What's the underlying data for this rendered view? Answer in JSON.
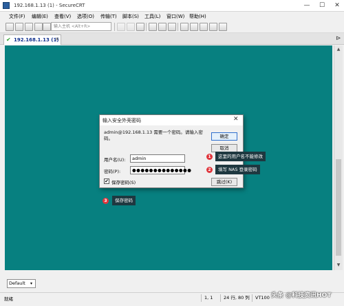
{
  "window": {
    "title": "192.168.1.13 (1) - SecureCRT",
    "minimize": "—",
    "maximize": "☐",
    "close": "✕"
  },
  "menu": [
    "文件(F)",
    "编辑(E)",
    "查看(V)",
    "选项(O)",
    "传输(T)",
    "脚本(S)",
    "工具(L)",
    "窗口(W)",
    "帮助(H)"
  ],
  "toolbar": {
    "quick_connect_placeholder": "输入主机 <Alt+R>"
  },
  "tab": {
    "label": "192.168.1.13 (1)",
    "close": "✕",
    "check": "✔",
    "pin": "⊳"
  },
  "dialog": {
    "title": "输入安全外壳密码",
    "close": "✕",
    "message": "admin@192.168.1.13 需要一个密码。请输入密码。",
    "ok_label": "确定",
    "cancel_label": "取消",
    "username_label": "用户名(U):",
    "username_value": "admin",
    "password_label": "密码(P):",
    "password_value": "●●●●●●●●●●●●●●",
    "save_password_label": "保存密码(S)",
    "save_password_checked": "✔",
    "skip_label": "跳过(K)"
  },
  "annotations": [
    {
      "number": "1",
      "text": "这里的用户名不能修改"
    },
    {
      "number": "2",
      "text": "填写 NAS 登录密码"
    },
    {
      "number": "3",
      "text": "保存密码"
    }
  ],
  "session_select": {
    "value": "Default",
    "arrow": "▾"
  },
  "statusbar": {
    "status": "就绪",
    "position": "1,  1",
    "size": "24 行, 80 列",
    "term": "VT100"
  },
  "watermark": "头条 @科技资讯HOT"
}
